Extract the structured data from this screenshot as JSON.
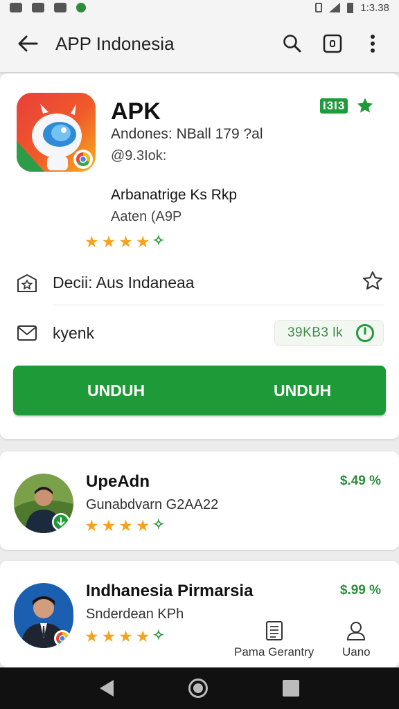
{
  "status_bar": {
    "time": "1:3.38"
  },
  "appbar": {
    "title": "APP Indonesia"
  },
  "app": {
    "name": "APK",
    "rating_badge": "I3I3",
    "developer_line": "Andones: NBall 179 ?al",
    "secondary_line": "@9.3Iok:",
    "tagline": "Arbanatrige Ks Rkp",
    "version": "Aaten (A9P",
    "stars_full": 4,
    "stars_partial": 1
  },
  "rows": {
    "detail_text": "Decii: Aus Indaneaa",
    "size_text": "kyenk",
    "size_pill": "39KB3 lk"
  },
  "install_button": {
    "label_left": "UNDUH",
    "label_right": "UNDUH"
  },
  "list": [
    {
      "title": "UpeAdn",
      "subtitle": "Gunabdvarn G2AA22",
      "price": "$.49 %",
      "stars_full": 4,
      "stars_partial": 1
    },
    {
      "title": "Indhanesia Pirmarsia",
      "subtitle": "Snderdean KPh",
      "price": "$.99 %",
      "stars_full": 4,
      "stars_partial": 1
    }
  ],
  "bottom_nav": {
    "item1": "Pama Gerantry",
    "item2": "Uano"
  },
  "colors": {
    "accent_green": "#1f9a39",
    "star": "#f6a21e"
  }
}
